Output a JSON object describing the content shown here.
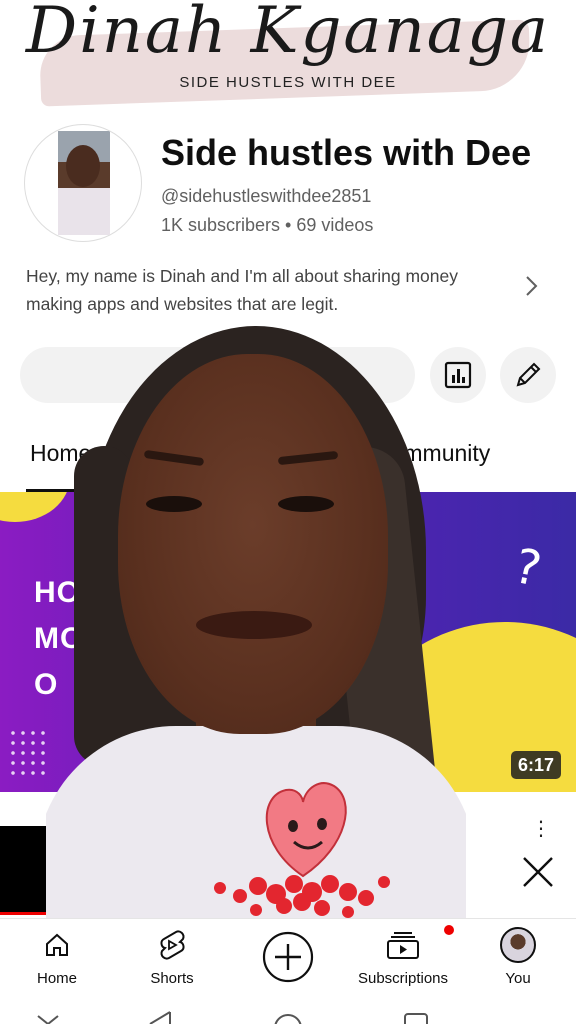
{
  "banner": {
    "script_text": "Dinah Kganaga",
    "tagline": "SIDE HUSTLES  WITH DEE"
  },
  "channel": {
    "name": "Side hustles with Dee",
    "handle": "@sidehustleswithdee2851",
    "stats": "1K subscribers • 69 videos",
    "description": "Hey, my name is Dinah and I'm all about sharing money making apps and websites that are legit."
  },
  "tabs": [
    {
      "label": "Home"
    },
    {
      "label": "Community"
    }
  ],
  "video": {
    "thumb_text_lines": [
      "HOW",
      "MON",
      "O"
    ],
    "duration": "6:17"
  },
  "bottom_nav": [
    {
      "label": "Home",
      "icon": "home-icon"
    },
    {
      "label": "Shorts",
      "icon": "shorts-icon"
    },
    {
      "label": "",
      "icon": "create-icon"
    },
    {
      "label": "Subscriptions",
      "icon": "subscriptions-icon"
    },
    {
      "label": "You",
      "icon": "avatar"
    }
  ],
  "colors": {
    "accent_red": "#e00000",
    "thumb_purple": "#5a1fb8",
    "thumb_yellow": "#f5dc3f",
    "text_secondary": "#606060"
  }
}
